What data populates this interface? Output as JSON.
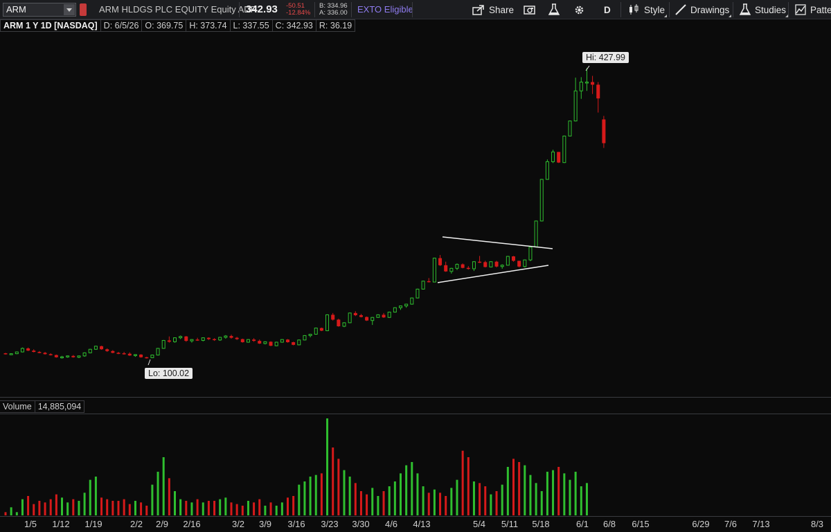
{
  "toolbar": {
    "symbol": "ARM",
    "description": "ARM HLDGS PLC EQUITY Equity ADR",
    "last": "342.93",
    "change": "-50.51",
    "change_pct": "-12.84%",
    "bid": "B: 334.96",
    "ask": "A: 336.00",
    "exto": "EXTO Eligible",
    "share_label": "Share",
    "interval_label": "D",
    "style_label": "Style",
    "drawings_label": "Drawings",
    "studies_label": "Studies",
    "patterns_label": "Patter"
  },
  "info": {
    "symbol_period": "ARM 1 Y 1D [NASDAQ]",
    "date": "D: 6/5/26",
    "open": "O: 369.75",
    "high": "H: 373.74",
    "low": "L: 337.55",
    "close": "C: 342.93",
    "range": "R: 36.19"
  },
  "volume_header": {
    "label": "Volume",
    "value": "14,885,094"
  },
  "annotations": {
    "hi_label": "Hi: 427.99",
    "lo_label": "Lo: 100.02"
  },
  "colors": {
    "up": "#2fbf2f",
    "down": "#d61a1a",
    "background": "#0b0b0b",
    "toolbar": "#1c1d20",
    "exto": "#8f7cf0"
  },
  "chart_data": {
    "type": "candlestick",
    "x_tick_labels": [
      "1/5",
      "1/12",
      "1/19",
      "2/2",
      "2/9",
      "2/16",
      "3/2",
      "3/9",
      "3/16",
      "3/23",
      "3/30",
      "4/6",
      "4/13",
      "5/4",
      "5/11",
      "5/18",
      "6/1",
      "6/8",
      "6/15",
      "6/29",
      "7/6",
      "7/13",
      "8/3"
    ],
    "price_ohlc": [
      [
        105.5,
        106,
        104,
        104.5
      ],
      [
        104.5,
        105.5,
        103.5,
        105
      ],
      [
        105,
        107.5,
        104.5,
        107
      ],
      [
        107,
        112,
        106.5,
        111
      ],
      [
        111,
        112,
        108,
        108.5
      ],
      [
        108.5,
        110,
        106.5,
        107
      ],
      [
        107,
        108,
        105.5,
        106
      ],
      [
        106,
        107,
        104,
        104.5
      ],
      [
        104.5,
        105.5,
        103,
        103.5
      ],
      [
        103.5,
        104,
        100.5,
        101
      ],
      [
        101,
        102.5,
        99.5,
        101.5
      ],
      [
        101.5,
        103,
        100.5,
        102.5
      ],
      [
        102.5,
        103.5,
        100.5,
        101
      ],
      [
        101,
        103,
        100,
        102.5
      ],
      [
        102.5,
        106.5,
        101.5,
        106
      ],
      [
        106,
        110.5,
        105.5,
        110
      ],
      [
        110,
        114,
        109.5,
        113.5
      ],
      [
        113.5,
        114,
        109.5,
        110
      ],
      [
        110,
        111,
        107,
        108
      ],
      [
        108,
        109,
        105.5,
        106
      ],
      [
        106,
        107,
        104.5,
        105.5
      ],
      [
        105.5,
        107,
        104,
        105
      ],
      [
        105,
        106.5,
        102.5,
        103
      ],
      [
        103,
        104.5,
        101.5,
        104
      ],
      [
        104,
        104.5,
        100.5,
        101
      ],
      [
        101,
        101.5,
        99.5,
        100.5
      ],
      [
        100.5,
        104,
        100.02,
        103.5
      ],
      [
        103.5,
        111.5,
        103,
        111
      ],
      [
        111,
        120.5,
        110.5,
        120
      ],
      [
        120,
        124.5,
        117.5,
        118.5
      ],
      [
        118.5,
        123.5,
        117.5,
        123
      ],
      [
        123,
        125.5,
        121.5,
        124.5
      ],
      [
        124.5,
        125,
        118.5,
        119.5
      ],
      [
        119.5,
        121.5,
        117.5,
        121
      ],
      [
        121,
        123,
        119.5,
        120
      ],
      [
        120,
        123.5,
        119,
        123
      ],
      [
        123,
        123.5,
        120.5,
        121.5
      ],
      [
        121.5,
        122.5,
        119.5,
        120.5
      ],
      [
        120.5,
        124,
        119.5,
        123.5
      ],
      [
        123.5,
        126,
        122,
        125
      ],
      [
        125,
        126.5,
        122,
        123
      ],
      [
        123,
        124,
        120.5,
        121.5
      ],
      [
        121.5,
        122,
        117.5,
        118
      ],
      [
        118,
        121.5,
        117.5,
        121
      ],
      [
        121,
        122.5,
        118.5,
        119.5
      ],
      [
        119.5,
        121,
        116,
        116.5
      ],
      [
        116.5,
        119,
        115.5,
        118.5
      ],
      [
        118.5,
        119,
        113.5,
        114
      ],
      [
        114,
        118.5,
        113.5,
        118
      ],
      [
        118,
        121.5,
        117.5,
        121
      ],
      [
        121,
        121.5,
        117.5,
        118
      ],
      [
        118,
        118.5,
        114.5,
        115
      ],
      [
        115,
        121,
        114.5,
        120.5
      ],
      [
        120.5,
        126,
        120,
        125.5
      ],
      [
        125.5,
        127.5,
        123.5,
        127
      ],
      [
        127,
        134.5,
        126.5,
        134
      ],
      [
        134,
        134.5,
        130.5,
        131
      ],
      [
        131,
        149.5,
        130.5,
        149
      ],
      [
        149,
        151,
        142.5,
        143.5
      ],
      [
        143.5,
        144.5,
        135.5,
        136
      ],
      [
        136,
        140.5,
        135,
        140
      ],
      [
        140,
        151.5,
        139.5,
        151
      ],
      [
        151,
        153,
        147.5,
        148.5
      ],
      [
        148.5,
        150,
        146,
        146.5
      ],
      [
        146.5,
        147,
        142,
        142.5
      ],
      [
        142.5,
        146.5,
        137.5,
        146
      ],
      [
        146,
        149.5,
        145.5,
        149
      ],
      [
        149,
        151,
        145.5,
        146
      ],
      [
        146,
        152.5,
        145.5,
        152
      ],
      [
        152,
        157.5,
        151.5,
        157
      ],
      [
        157,
        159.5,
        154.5,
        159
      ],
      [
        159,
        161.5,
        157,
        161
      ],
      [
        161,
        168.5,
        160.5,
        168
      ],
      [
        168,
        178.5,
        167.5,
        178
      ],
      [
        178,
        187.5,
        177.5,
        187
      ],
      [
        187,
        190.5,
        185.5,
        186
      ],
      [
        186,
        213.5,
        186,
        213
      ],
      [
        213,
        216.5,
        204,
        205
      ],
      [
        205,
        209,
        197.5,
        198
      ],
      [
        198,
        202,
        195.5,
        201.5
      ],
      [
        201.5,
        207,
        199.5,
        206
      ],
      [
        206,
        207,
        201.5,
        202
      ],
      [
        202,
        204,
        200,
        201
      ],
      [
        201,
        209.5,
        198.5,
        209
      ],
      [
        209,
        215.5,
        207.5,
        208.5
      ],
      [
        208.5,
        210,
        202.5,
        203
      ],
      [
        203,
        209.5,
        202.5,
        209
      ],
      [
        209,
        210,
        202.5,
        203.5
      ],
      [
        203.5,
        206,
        201,
        205
      ],
      [
        205,
        215.5,
        204.5,
        215
      ],
      [
        215,
        215.5,
        209,
        210
      ],
      [
        210,
        210,
        202.5,
        203.5
      ],
      [
        203.5,
        211.5,
        202.5,
        211
      ],
      [
        211,
        226,
        209.5,
        225.5
      ],
      [
        225.5,
        255.5,
        225,
        255
      ],
      [
        255,
        302.5,
        254.5,
        302
      ],
      [
        302,
        324.5,
        301.5,
        322
      ],
      [
        322,
        335.5,
        320.5,
        333
      ],
      [
        333,
        333,
        320.5,
        321
      ],
      [
        321,
        351.5,
        320.5,
        351
      ],
      [
        351,
        368.5,
        350.5,
        368
      ],
      [
        368,
        417,
        367.5,
        402
      ],
      [
        402,
        417.5,
        393,
        412
      ],
      [
        412,
        427.99,
        402,
        412
      ],
      [
        412,
        419,
        398.5,
        409
      ],
      [
        409,
        412,
        377.5,
        393.5
      ],
      [
        369.75,
        373.74,
        337.55,
        342.93
      ]
    ],
    "volume": [
      2,
      5,
      2,
      10,
      12,
      7,
      9,
      8,
      10,
      13,
      11,
      8,
      10,
      9,
      14,
      22,
      24,
      11,
      10,
      9,
      9,
      10,
      7,
      9,
      8,
      6,
      19,
      27,
      36,
      23,
      15,
      10,
      9,
      8,
      10,
      8,
      9,
      9,
      10,
      11,
      8,
      7,
      6,
      9,
      8,
      10,
      6,
      8,
      6,
      8,
      11,
      12,
      19,
      21,
      24,
      25,
      26,
      60,
      42,
      35,
      28,
      24,
      20,
      15,
      13,
      17,
      12,
      15,
      18,
      21,
      26,
      31,
      33,
      26,
      18,
      14,
      16,
      14,
      12,
      17,
      22,
      40,
      36,
      21,
      20,
      18,
      13,
      15,
      19,
      30,
      35,
      33,
      31,
      25,
      20,
      15,
      27,
      28,
      30,
      26,
      22,
      27,
      18,
      20
    ]
  }
}
